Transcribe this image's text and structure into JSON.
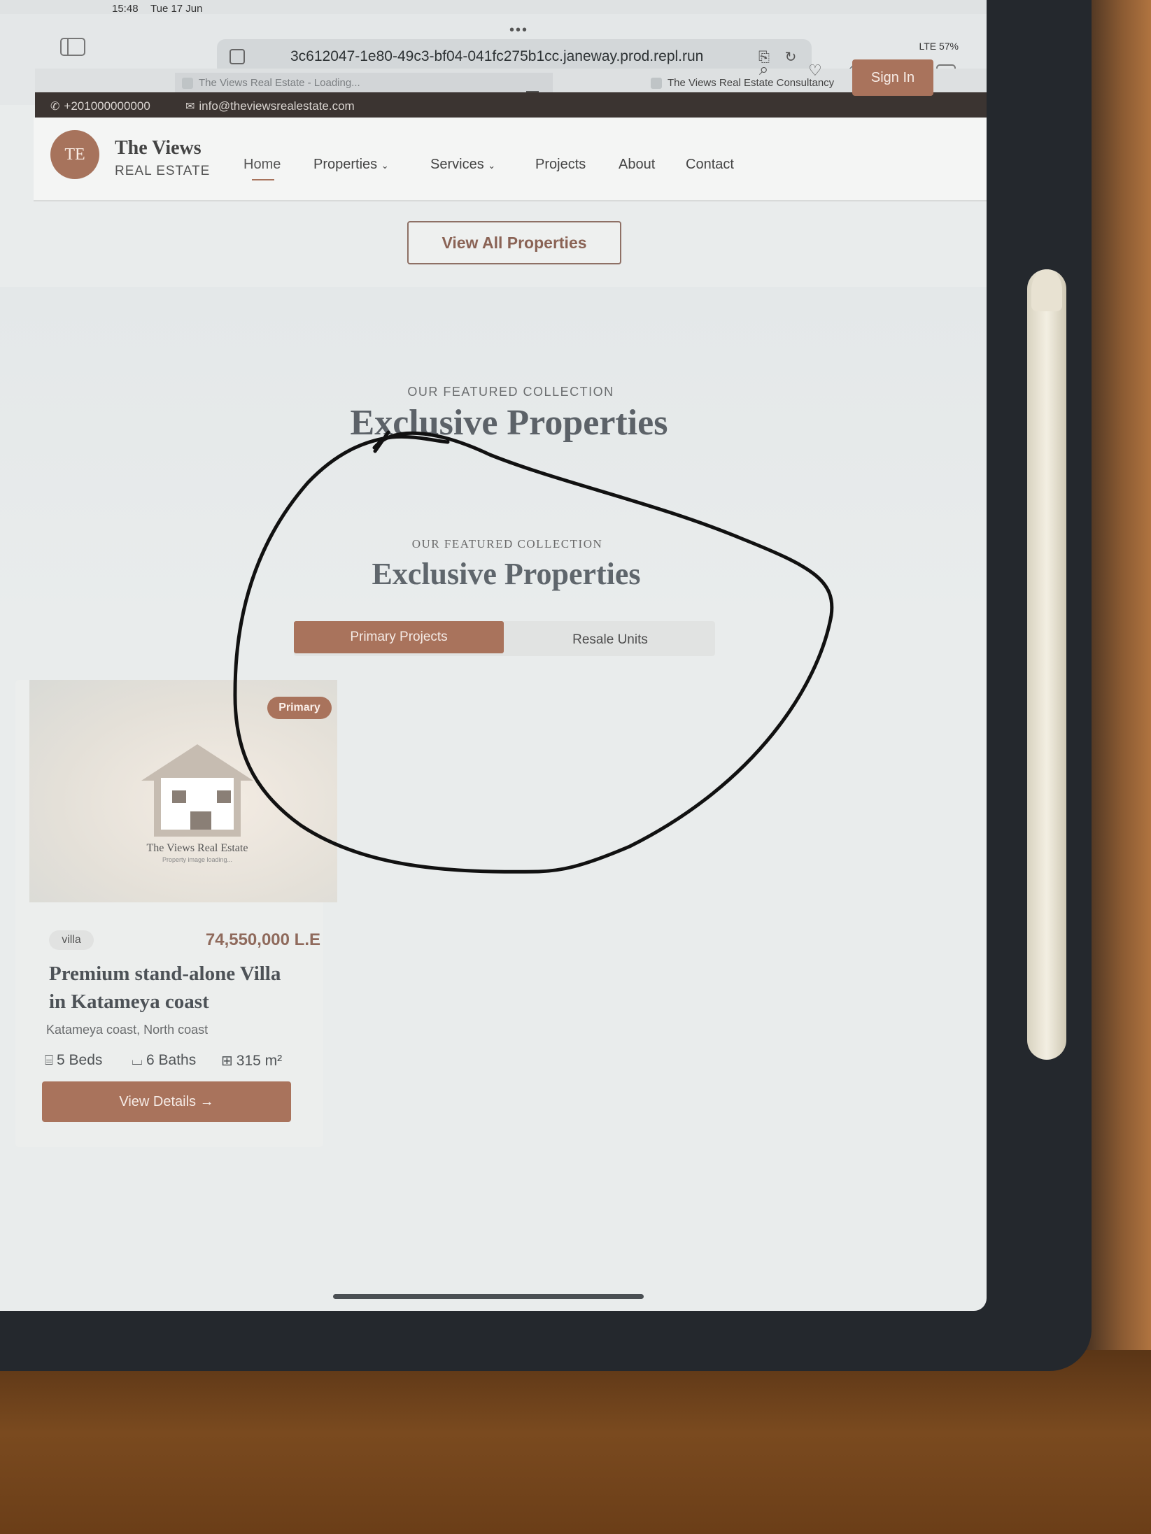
{
  "status_bar": {
    "time": "15:48",
    "date": "Tue 17 Jun",
    "signal": "LTE 57%"
  },
  "browser": {
    "url": "3c612047-1e80-49c3-bf04-041fc275b1cc.janeway.prod.repl.run",
    "tabs": [
      {
        "title": "The Views Real Estate - Loading..."
      },
      {
        "title": "The Views Real Estate Consultancy"
      }
    ]
  },
  "topbar": {
    "phone": "+201000000000",
    "email": "info@theviewsrealestate.com"
  },
  "header": {
    "logo_initials": "TE",
    "logo_title": "The Views",
    "logo_subtitle": "REAL ESTATE",
    "nav": {
      "home": "Home",
      "properties": "Properties",
      "services": "Services",
      "projects": "Projects",
      "about": "About",
      "contact": "Contact"
    },
    "sign_in": "Sign In"
  },
  "view_all_label": "View All Properties",
  "featured_upper": {
    "eyebrow": "OUR FEATURED COLLECTION",
    "heading": "Exclusive Properties"
  },
  "featured_lower": {
    "eyebrow": "OUR FEATURED COLLECTION",
    "heading": "Exclusive Properties",
    "toggle": {
      "primary": "Primary Projects",
      "resale": "Resale Units"
    }
  },
  "property_card": {
    "badge": "Primary",
    "image_caption": "The Views Real Estate",
    "image_loading": "Property image loading...",
    "type": "villa",
    "price": "74,550,000 L.E",
    "title": "Premium stand-alone Villa in Katameya coast",
    "location": "Katameya coast, North coast",
    "beds": "5 Beds",
    "baths": "6 Baths",
    "area": "315 m²",
    "cta": "View Details"
  },
  "colors": {
    "brand": "#a9735c",
    "topbar": "#3b3431"
  },
  "icons": {
    "phone": "phone-icon",
    "mail": "mail-icon",
    "search": "search-icon",
    "heart": "heart-icon",
    "bed": "bed-icon",
    "bath": "bath-icon",
    "area": "area-icon",
    "arrow": "arrow-right-icon"
  }
}
